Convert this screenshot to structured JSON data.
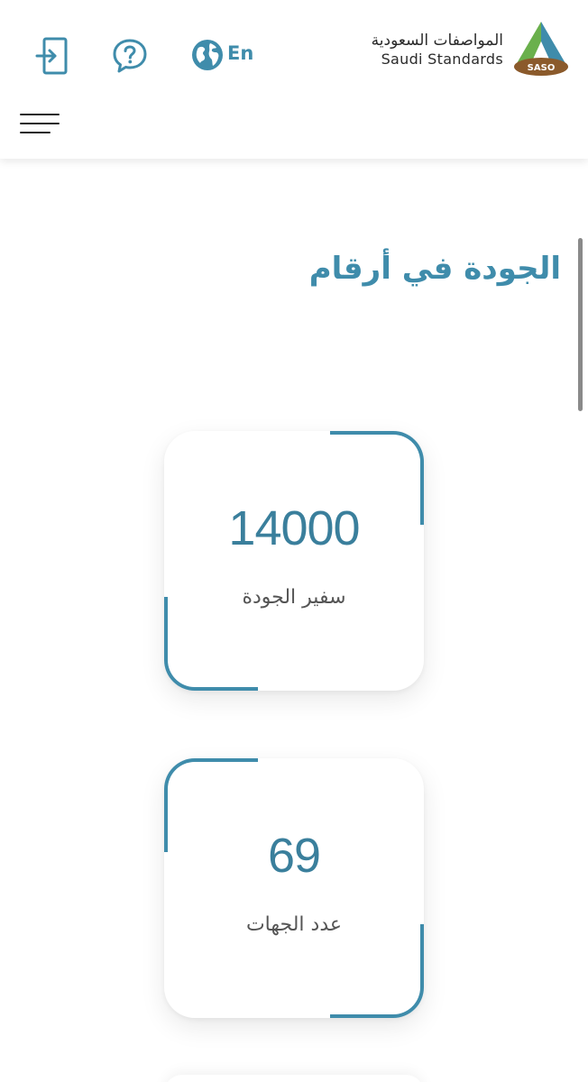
{
  "header": {
    "logo": {
      "name_ar": "المواصفات السعودية",
      "name_en": "Saudi Standards",
      "badge": "SASO"
    },
    "language_label": "En",
    "icons": {
      "login": "login-icon",
      "help": "help-icon",
      "language": "globe-icon",
      "menu": "hamburger-menu-icon"
    }
  },
  "section": {
    "title": "الجودة في أرقام"
  },
  "stats": [
    {
      "value": "14000",
      "label": "سفير الجودة"
    },
    {
      "value": "69",
      "label": "عدد الجهات"
    }
  ],
  "colors": {
    "accent": "#3f8cab",
    "stat_value": "#3a7f9c",
    "text": "#555555",
    "logo_green": "#6ab04c",
    "logo_blue": "#3f8cab",
    "logo_brown": "#8b5a2b"
  }
}
